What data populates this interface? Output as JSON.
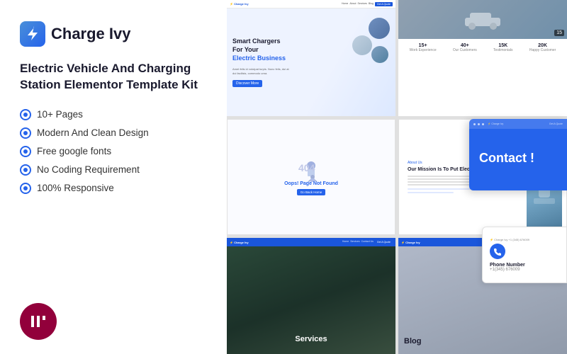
{
  "logo": {
    "text": "Charge Ivy",
    "icon": "bolt-icon"
  },
  "tagline": "Electric Vehicle And Charging Station Elementor Template Kit",
  "features": [
    {
      "id": "pages",
      "text": "10+ Pages"
    },
    {
      "id": "design",
      "text": "Modern And Clean Design"
    },
    {
      "id": "fonts",
      "text": "Free google fonts"
    },
    {
      "id": "coding",
      "text": "No Coding Requirement"
    },
    {
      "id": "responsive",
      "text": "100% Responsive"
    }
  ],
  "stats": [
    {
      "number": "15+",
      "label": "Work Experience"
    },
    {
      "number": "40+",
      "label": "Our Customers"
    },
    {
      "number": "15K",
      "label": "Testimonials"
    },
    {
      "number": "20K",
      "label": "Happy Customer"
    }
  ],
  "hero": {
    "title_line1": "Smart Chargers",
    "title_line2": "For Your",
    "title_line3": "Electric Business",
    "button": "Discover More"
  },
  "about": {
    "tag": "About Us",
    "title": "Our Mission Is To Put Electric Vehicle Change"
  },
  "sections": {
    "services": "Services",
    "blog": "Blog",
    "contact": "Contact !"
  },
  "phone": {
    "label": "Phone Number",
    "number": "+1(345) 676009"
  },
  "stats_img_overlay": "15",
  "error404": {
    "number": "404",
    "message": "Oops! Page Not Found",
    "button": "Go Back Home"
  },
  "elementor": {
    "badge_letter": "E"
  }
}
